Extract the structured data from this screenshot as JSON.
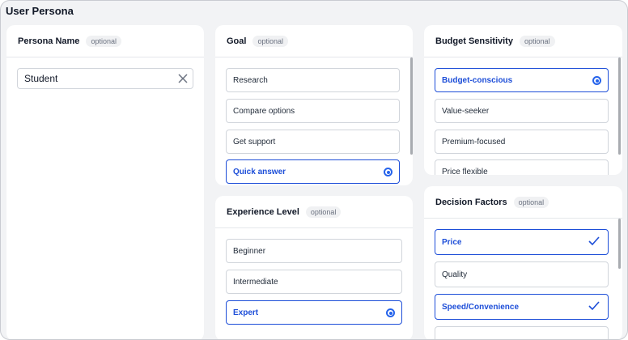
{
  "page_title": "User Persona",
  "persona_name": {
    "title": "Persona Name",
    "badge": "optional",
    "input_value": "Student"
  },
  "goal": {
    "title": "Goal",
    "badge": "optional",
    "options": [
      {
        "label": "Research",
        "selected": false
      },
      {
        "label": "Compare options",
        "selected": false
      },
      {
        "label": "Get support",
        "selected": false
      },
      {
        "label": "Quick answer",
        "selected": true
      }
    ]
  },
  "budget": {
    "title": "Budget Sensitivity",
    "badge": "optional",
    "options": [
      {
        "label": "Budget-conscious",
        "selected": true
      },
      {
        "label": "Value-seeker",
        "selected": false
      },
      {
        "label": "Premium-focused",
        "selected": false
      },
      {
        "label": "Price flexible",
        "selected": false
      }
    ]
  },
  "experience": {
    "title": "Experience Level",
    "badge": "optional",
    "options": [
      {
        "label": "Beginner",
        "selected": false
      },
      {
        "label": "Intermediate",
        "selected": false
      },
      {
        "label": "Expert",
        "selected": true
      }
    ]
  },
  "decision": {
    "title": "Decision Factors",
    "badge": "optional",
    "options": [
      {
        "label": "Price",
        "checked": true
      },
      {
        "label": "Quality",
        "checked": false
      },
      {
        "label": "Speed/Convenience",
        "checked": true
      }
    ]
  },
  "colors": {
    "accent": "#1d4ed8",
    "background": "#f2f3f5",
    "card": "#ffffff",
    "border": "#d1d5db"
  },
  "icons": [
    "clear-icon",
    "radio-selected-icon",
    "checkmark-icon"
  ]
}
